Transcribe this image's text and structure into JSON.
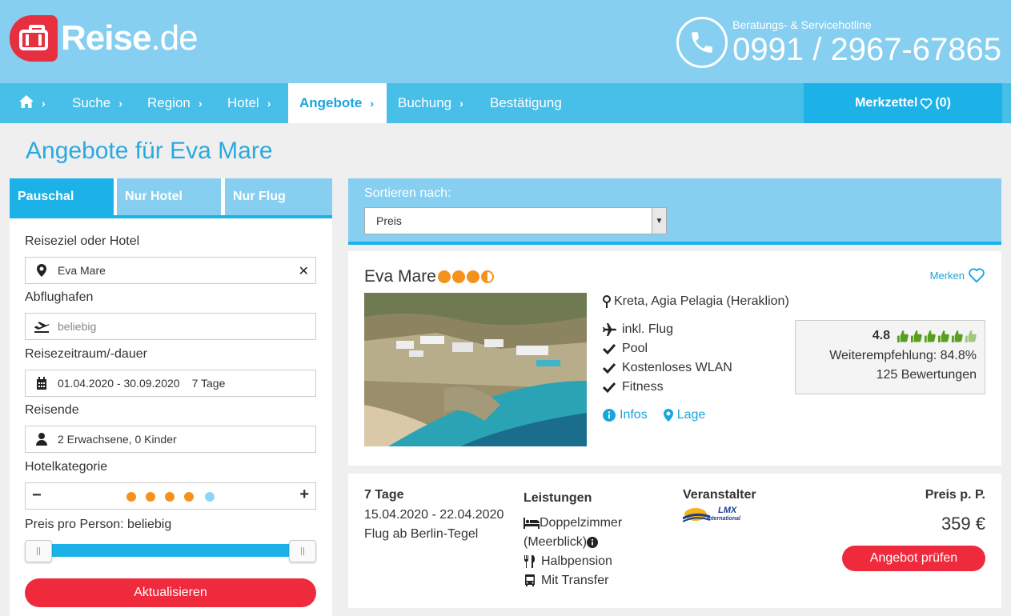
{
  "header": {
    "logo_main": "Reise",
    "logo_suffix": ".de",
    "hotline_label": "Beratungs- & Servicehotline",
    "hotline_number": "0991 / 2967-67865"
  },
  "nav": {
    "items": [
      "Suche",
      "Region",
      "Hotel",
      "Angebote",
      "Buchung",
      "Bestätigung"
    ],
    "active": "Angebote",
    "merkzettel_label": "Merkzettel",
    "merkzettel_count": "(0)"
  },
  "page_title": "Angebote für Eva Mare",
  "sidebar": {
    "tabs": [
      "Pauschal",
      "Nur Hotel",
      "Nur Flug"
    ],
    "active_tab": "Pauschal",
    "destination_label": "Reiseziel oder Hotel",
    "destination_value": "Eva Mare",
    "airport_label": "Abflughafen",
    "airport_placeholder": "beliebig",
    "period_label": "Reisezeitraum/-dauer",
    "period_value": "01.04.2020 - 30.09.2020",
    "duration_value": "7 Tage",
    "travelers_label": "Reisende",
    "travelers_value": "2 Erwachsene, 0 Kinder",
    "category_label": "Hotelkategorie",
    "category_selected": 4,
    "category_max": 5,
    "price_label": "Preis pro Person: beliebig",
    "update_button": "Aktualisieren"
  },
  "sort": {
    "label": "Sortieren nach:",
    "value": "Preis"
  },
  "hotel": {
    "name": "Eva Mare",
    "stars": 3.5,
    "merken_label": "Merken",
    "location": "Kreta, Agia Pelagia (Heraklion)",
    "features": [
      "inkl. Flug",
      "Pool",
      "Kostenloses WLAN",
      "Fitness"
    ],
    "links": [
      "Infos",
      "Lage"
    ],
    "rating": {
      "score": "4.8",
      "thumbs": 5.5,
      "recommendation": "Weiterempfehlung: 84.8%",
      "reviews": "125 Bewertungen"
    }
  },
  "offer": {
    "duration": "7 Tage",
    "dates": "15.04.2020 - 22.04.2020",
    "flight": "Flug ab Berlin-Tegel",
    "services_heading": "Leistungen",
    "room_line1": "Doppelzimmer",
    "room_line2": "(Meerblick)",
    "board": "Halbpension",
    "transfer": "Mit Transfer",
    "operator_heading": "Veranstalter",
    "operator_logo_text": "LMX",
    "operator_logo_sub": "International",
    "price_heading": "Preis p. P.",
    "price": "359 €",
    "cta": "Angebot prüfen"
  },
  "colors": {
    "header_bg": "#87cff0",
    "nav_bg": "#47bfe8",
    "accent": "#1cb2e8",
    "brand_red": "#e63040",
    "button_red": "#ee2a3c",
    "star_orange": "#f5921e",
    "thumb_green": "#5a9e1e"
  }
}
